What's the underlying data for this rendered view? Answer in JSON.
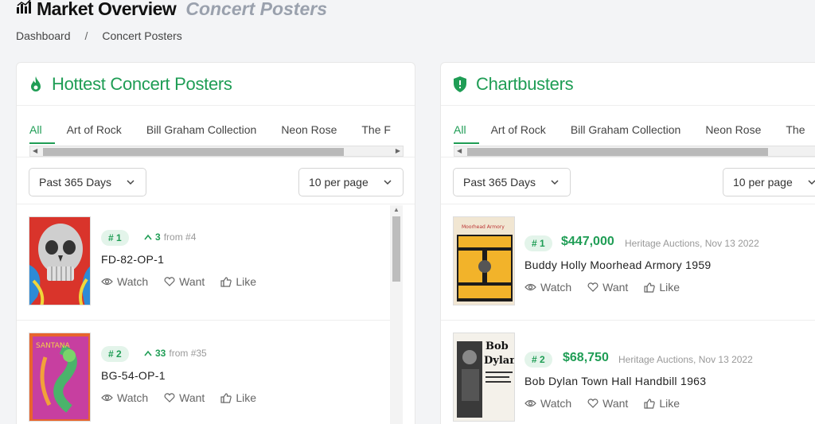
{
  "header": {
    "title": "Market Overview",
    "subtitle": "Concert Posters",
    "icon": "bar-chart-icon"
  },
  "breadcrumb": {
    "items": [
      "Dashboard",
      "Concert Posters"
    ],
    "separator": "/"
  },
  "colors": {
    "accent": "#1f9d55",
    "badge_bg": "#e3f4ea"
  },
  "hottest": {
    "title": "Hottest Concert Posters",
    "icon": "fire-icon",
    "tabs": [
      "All",
      "Art of Rock",
      "Bill Graham Collection",
      "Neon Rose",
      "The F"
    ],
    "period_select": "Past 365 Days",
    "per_page_select": "10 per page",
    "items": [
      {
        "rank": "# 1",
        "change": "3",
        "from": "from #4",
        "name": "FD-82-OP-1",
        "actions": [
          "Watch",
          "Want",
          "Like"
        ]
      },
      {
        "rank": "# 2",
        "change": "33",
        "from": "from #35",
        "name": "BG-54-OP-1",
        "actions": [
          "Watch",
          "Want",
          "Like"
        ]
      }
    ]
  },
  "chartbusters": {
    "title": "Chartbusters",
    "icon": "shield-icon",
    "tabs": [
      "All",
      "Art of Rock",
      "Bill Graham Collection",
      "Neon Rose",
      "The"
    ],
    "period_select": "Past 365 Days",
    "per_page_select": "10 per page",
    "items": [
      {
        "rank": "# 1",
        "price": "$447,000",
        "sale": "Heritage Auctions, Nov 13 2022",
        "name": "Buddy Holly Moorhead Armory 1959",
        "actions": [
          "Watch",
          "Want",
          "Like"
        ]
      },
      {
        "rank": "# 2",
        "price": "$68,750",
        "sale": "Heritage Auctions, Nov 13 2022",
        "name": "Bob Dylan Town Hall Handbill 1963",
        "actions": [
          "Watch",
          "Want",
          "Like"
        ]
      }
    ]
  }
}
